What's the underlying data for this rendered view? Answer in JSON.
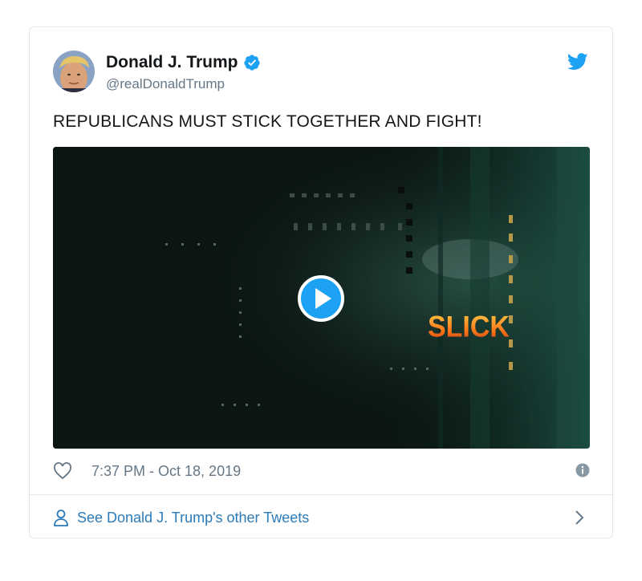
{
  "tweet": {
    "author_name": "Donald J. Trump",
    "handle": "@realDonaldTrump",
    "text": "REPUBLICANS MUST STICK TOGETHER AND FIGHT!",
    "timestamp": "7:37 PM - Oct 18, 2019",
    "video_overlay_text": "SLICK",
    "verified": true
  },
  "footer": {
    "other_tweets_label": "See Donald J. Trump's other Tweets"
  },
  "icons": {
    "verified": "verified-badge-icon",
    "brand": "twitter-bird-icon",
    "play": "play-icon",
    "like": "heart-icon",
    "info": "info-icon",
    "profile": "person-icon",
    "chevron": "chevron-right-icon"
  },
  "colors": {
    "brand_blue": "#1da1f2",
    "link_blue": "#2b7bb9",
    "text_dark": "#14171a",
    "text_gray": "#657786",
    "border": "#e1e8ed"
  }
}
